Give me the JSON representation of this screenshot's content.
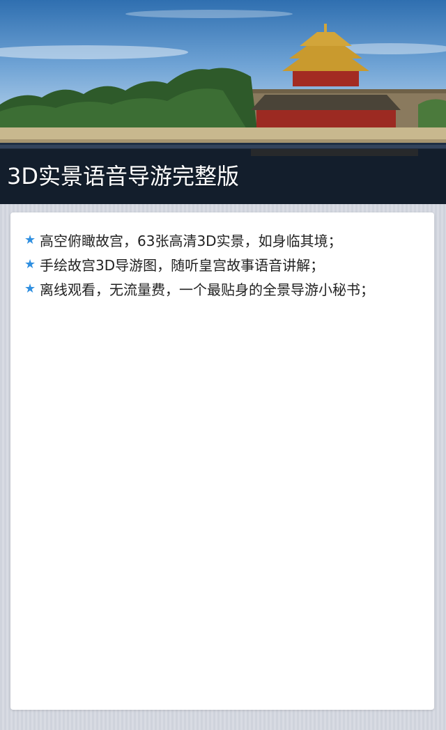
{
  "hero": {
    "caption": "3D实景语音导游完整版",
    "image_alt": "Forbidden City corner tower with moat and willow trees"
  },
  "features": [
    {
      "icon": "star-icon",
      "text": "高空俯瞰故宫，63张高清3D实景，如身临其境；"
    },
    {
      "icon": "star-icon",
      "text": "手绘故宫3D导游图，随听皇宫故事语音讲解；"
    },
    {
      "icon": "star-icon",
      "text": "离线观看，无流量费，一个最贴身的全景导游小秘书；"
    }
  ],
  "colors": {
    "accent_star": "#2f8fe0",
    "caption_text": "#ffffff",
    "card_bg": "#ffffff"
  }
}
